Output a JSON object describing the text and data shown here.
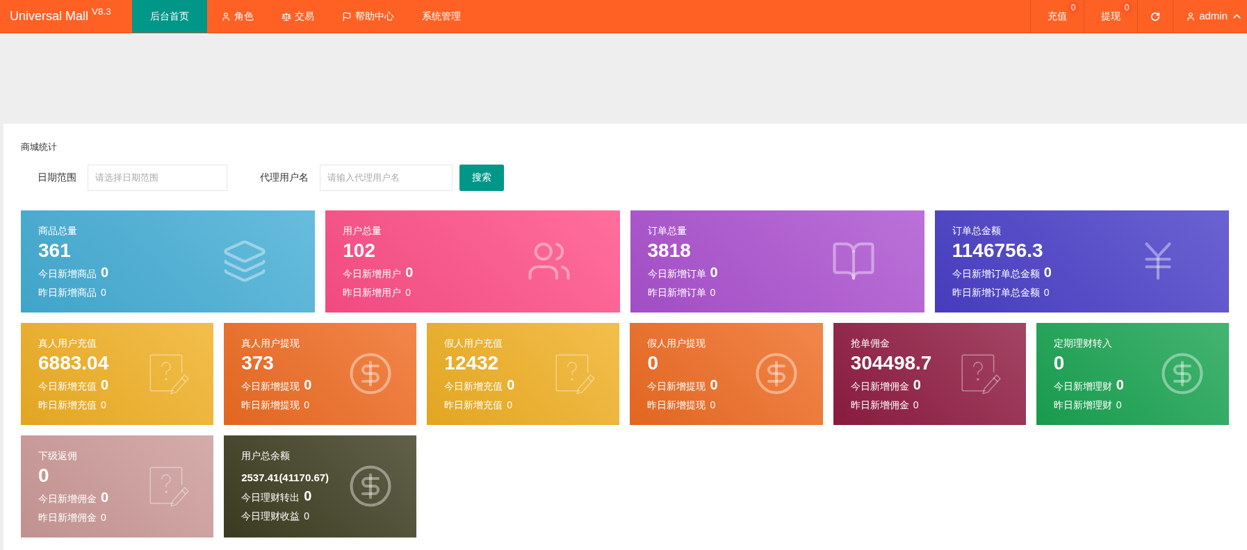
{
  "header": {
    "logo": "Universal Mall$^{V8.3}$",
    "nav": [
      {
        "label": "后台首页",
        "kind": "plain",
        "selected": true
      },
      {
        "label": "角色",
        "kind": "user",
        "selected": false
      },
      {
        "label": "交易",
        "kind": "scale",
        "selected": false
      },
      {
        "label": "帮助中心",
        "kind": "flag",
        "selected": false
      },
      {
        "label": "系统管理",
        "kind": "plain",
        "selected": false
      }
    ],
    "actions": [
      {
        "kind": "text",
        "label": "充值",
        "badge": "0"
      },
      {
        "kind": "text",
        "label": "提现",
        "badge": "0"
      },
      {
        "kind": "refresh"
      },
      {
        "kind": "user",
        "label": "admin"
      }
    ]
  },
  "panel": {
    "title": "商城统计",
    "form": [
      {
        "label": "日期范围",
        "placeholder": "请选择日期范围"
      },
      {
        "label": "代理用户名",
        "placeholder": "请输入代理用户名"
      }
    ],
    "search_button": "搜索",
    "card_rows": [
      [
        {
          "kind": "layers",
          "color": "#45aed6",
          "title": "商品总量",
          "value": "361",
          "today_label": "今日新增商品",
          "today": "0",
          "yesterday_label": "昨日新增商品",
          "yesterday": "0"
        },
        {
          "kind": "users",
          "color": "#ff4f88",
          "title": "用户总量",
          "value": "102",
          "today_label": "今日新增用户",
          "today": "0",
          "yesterday_label": "昨日新增用户",
          "yesterday": "0"
        },
        {
          "kind": "book",
          "color": "#ac52d0",
          "title": "订单总量",
          "value": "3818",
          "today_label": "今日新增订单",
          "today": "0",
          "yesterday_label": "昨日新增订单",
          "yesterday": "0"
        },
        {
          "kind": "yen",
          "color": "#4a40c8",
          "title": "订单总金额",
          "value": "1146756.3",
          "today_label": "今日新增订单总金额",
          "today": "0",
          "yesterday_label": "昨日新增订单总金额",
          "yesterday": "0"
        }
      ],
      [
        {
          "kind": "note",
          "color": "#f0b024",
          "title": "真人用户充值",
          "value": "6883.04",
          "today_label": "今日新增充值",
          "today": "0",
          "yesterday_label": "昨日新增充值",
          "yesterday": "0"
        },
        {
          "kind": "dollar",
          "color": "#ef6c23",
          "title": "真人用户提现",
          "value": "373",
          "today_label": "今日新增提现",
          "today": "0",
          "yesterday_label": "昨日新增提现",
          "yesterday": "0"
        },
        {
          "kind": "note",
          "color": "#f0b024",
          "title": "假人用户充值",
          "value": "12432",
          "today_label": "今日新增充值",
          "today": "0",
          "yesterday_label": "昨日新增充值",
          "yesterday": "0"
        },
        {
          "kind": "dollar",
          "color": "#ef6c23",
          "title": "假人用户提现",
          "value": "0",
          "today_label": "今日新增提现",
          "today": "0",
          "yesterday_label": "昨日新增提现",
          "yesterday": "0"
        },
        {
          "kind": "note",
          "color": "#901c42",
          "title": "抢单佣金",
          "value": "304498.7",
          "today_label": "今日新增佣金",
          "today": "0",
          "yesterday_label": "昨日新增佣金",
          "yesterday": "0"
        },
        {
          "kind": "dollar",
          "color": "#1aa452",
          "title": "定期理财转入",
          "value": "0",
          "today_label": "今日新增理财",
          "today": "0",
          "yesterday_label": "昨日新增理财",
          "yesterday": "0"
        }
      ],
      [
        {
          "kind": "note",
          "color": "#cc9a98",
          "title": "下级返佣",
          "value": "0",
          "today_label": "今日新增佣金",
          "today": "0",
          "yesterday_label": "昨日新增佣金",
          "yesterday": "0"
        },
        {
          "kind": "dollar",
          "color": "#3e3e22",
          "title": "用户总余额",
          "value": "2537.41(41170.67)",
          "small_value": true,
          "today_label": "今日理财转出",
          "today": "0",
          "yesterday_label": "今日理财收益",
          "yesterday": "0"
        }
      ]
    ]
  }
}
